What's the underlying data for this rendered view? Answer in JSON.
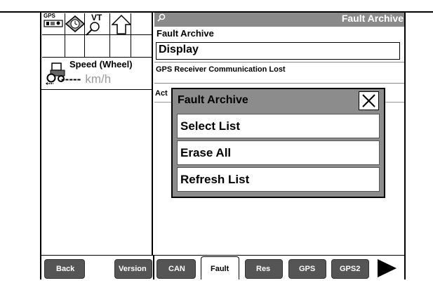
{
  "left_panel": {
    "icons": {
      "gps_label": "GPS",
      "vt_label": "VT",
      "gps_icon": "gps-receiver-icon",
      "clock_icon": "diamond-clock-icon",
      "magnifier_icon": "magnifier-icon",
      "arrow_icon": "up-arrow-icon"
    },
    "speed": {
      "label": "Speed (Wheel)",
      "value": "-----",
      "unit": "km/h",
      "icon": "tractor-icon"
    }
  },
  "header": {
    "title": "Fault Archive",
    "icon": "magnifier-icon",
    "bg_color": "#8a8a8a"
  },
  "form": {
    "label": "Fault Archive",
    "display_value": "Display",
    "fault_message": "GPS Receiver Communication Lost",
    "action_label": "Act"
  },
  "modal": {
    "title": "Fault Archive",
    "close_icon": "close-icon",
    "options": [
      "Select List",
      "Erase All",
      "Refresh List"
    ]
  },
  "bottom_bar": {
    "back": "Back",
    "version": "Version",
    "tabs": [
      "CAN",
      "Fault",
      "Res",
      "GPS",
      "GPS2"
    ],
    "active_tab": "Fault",
    "next_icon": "play-arrow-icon",
    "tab_color": "#555555"
  }
}
